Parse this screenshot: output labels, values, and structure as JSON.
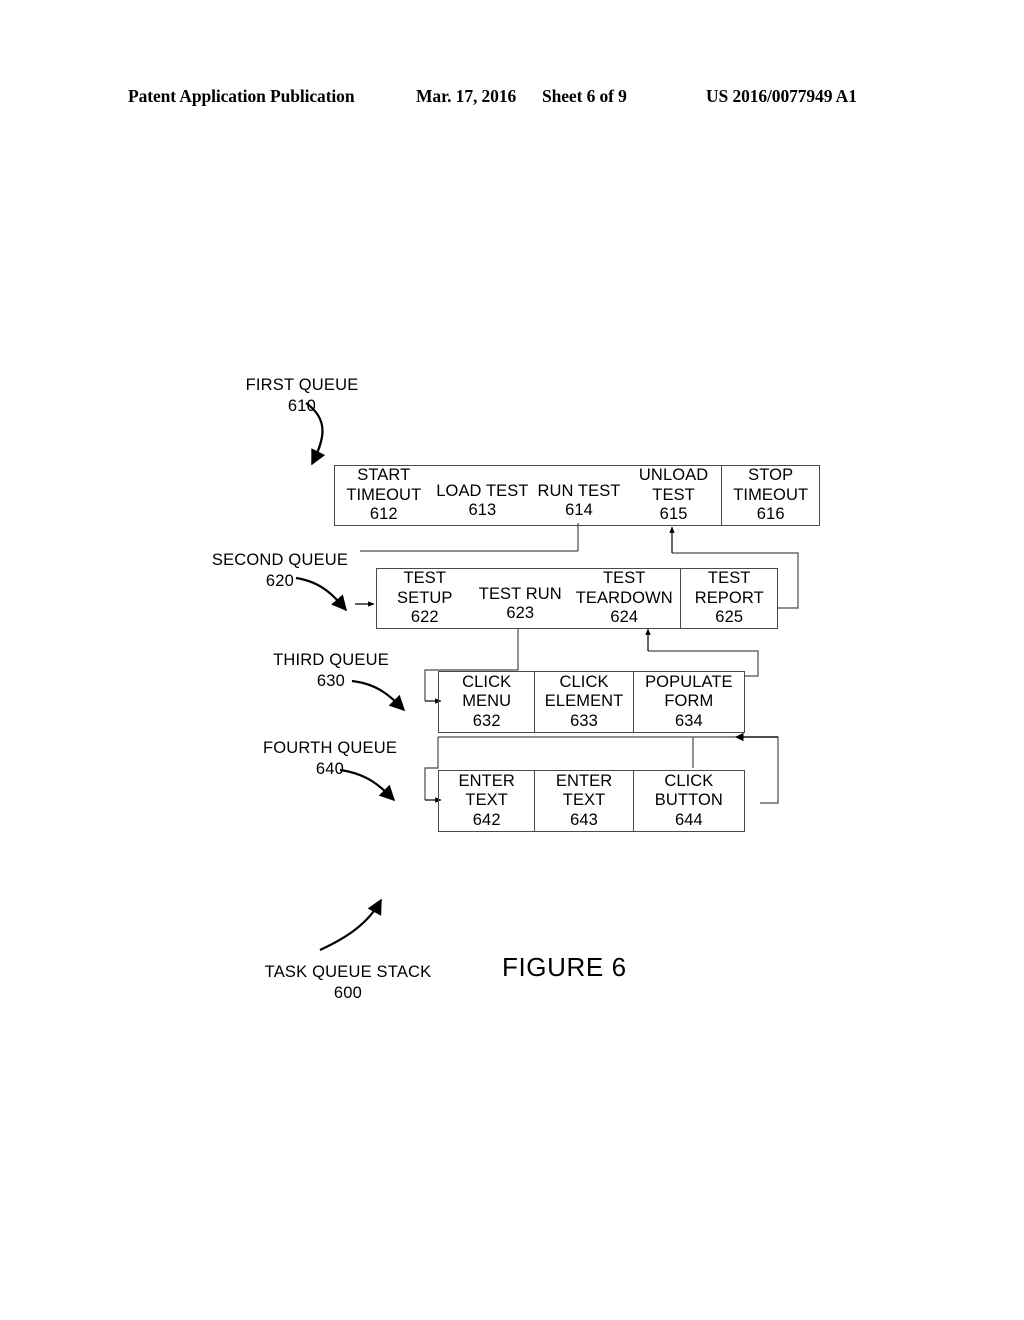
{
  "header": {
    "publication": "Patent Application Publication",
    "date": "Mar. 17, 2016",
    "sheet": "Sheet 6 of 9",
    "number": "US 2016/0077949 A1"
  },
  "figure": {
    "caption": "FIGURE 6",
    "stack_label": "TASK QUEUE STACK",
    "stack_number": "600"
  },
  "queues": [
    {
      "name": "first-queue",
      "label": "FIRST QUEUE",
      "number": "610",
      "cells": [
        {
          "label": "START\nTIMEOUT",
          "number": "612",
          "lines": 2
        },
        {
          "label": "LOAD TEST",
          "number": "613",
          "lines": 1
        },
        {
          "label": "RUN TEST",
          "number": "614",
          "lines": 1
        },
        {
          "label": "UNLOAD\nTEST",
          "number": "615",
          "lines": 2
        },
        {
          "label": "STOP\nTIMEOUT",
          "number": "616",
          "lines": 2
        }
      ]
    },
    {
      "name": "second-queue",
      "label": "SECOND QUEUE",
      "number": "620",
      "cells": [
        {
          "label": "TEST\nSETUP",
          "number": "622",
          "lines": 2
        },
        {
          "label": "TEST RUN",
          "number": "623",
          "lines": 1
        },
        {
          "label": "TEST\nTEARDOWN",
          "number": "624",
          "lines": 2
        },
        {
          "label": "TEST\nREPORT",
          "number": "625",
          "lines": 2
        }
      ]
    },
    {
      "name": "third-queue",
      "label": "THIRD QUEUE",
      "number": "630",
      "cells": [
        {
          "label": "CLICK\nMENU",
          "number": "632",
          "lines": 2
        },
        {
          "label": "CLICK\nELEMENT",
          "number": "633",
          "lines": 2
        },
        {
          "label": "POPULATE\nFORM",
          "number": "634",
          "lines": 2
        }
      ]
    },
    {
      "name": "fourth-queue",
      "label": "FOURTH QUEUE",
      "number": "640",
      "cells": [
        {
          "label": "ENTER\nTEXT",
          "number": "642",
          "lines": 2
        },
        {
          "label": "ENTER\nTEXT",
          "number": "643",
          "lines": 2
        },
        {
          "label": "CLICK\nBUTTON",
          "number": "644",
          "lines": 2
        }
      ]
    }
  ],
  "colors": {
    "ink": "#000000",
    "line": "#4a4a4a",
    "background": "#ffffff"
  }
}
